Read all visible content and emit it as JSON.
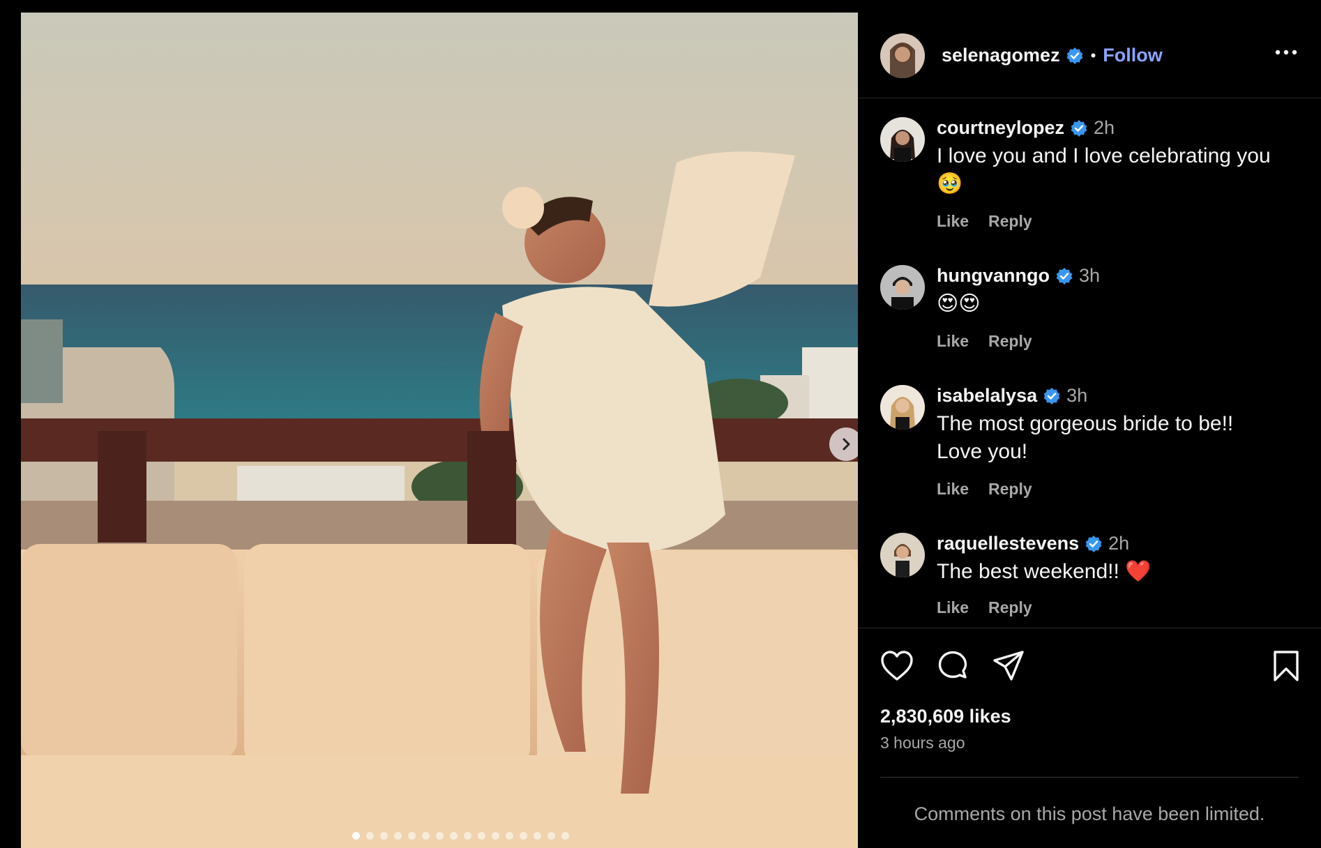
{
  "post": {
    "author": "selenagomez",
    "follow_label": "Follow",
    "separator": "•",
    "image_alt": "Woman in a cream floral dress sitting on a balcony sofa with the ocean behind",
    "carousel": {
      "total_slides": 16,
      "active_index": 0
    }
  },
  "comments": [
    {
      "username": "courtneylopez",
      "time": "2h",
      "text": "I love you and I love celebrating you 🥹",
      "like_label": "Like",
      "reply_label": "Reply"
    },
    {
      "username": "hungvanngo",
      "time": "3h",
      "text": "😍😍",
      "like_label": "Like",
      "reply_label": "Reply"
    },
    {
      "username": "isabelalysa",
      "time": "3h",
      "text": "The most gorgeous bride to be!! Love you!",
      "like_label": "Like",
      "reply_label": "Reply"
    },
    {
      "username": "raquellestevens",
      "time": "2h",
      "text": "The best weekend!! ❤️",
      "like_label": "Like",
      "reply_label": "Reply"
    }
  ],
  "stats": {
    "likes": "2,830,609 likes",
    "posted_ago": "3 hours ago"
  },
  "footer": {
    "limited_notice": "Comments on this post have been limited."
  },
  "colors": {
    "background": "#000000",
    "link_blue": "#8aa4ff",
    "verified_blue": "#3897f0",
    "muted_text": "#a8a8a8"
  }
}
